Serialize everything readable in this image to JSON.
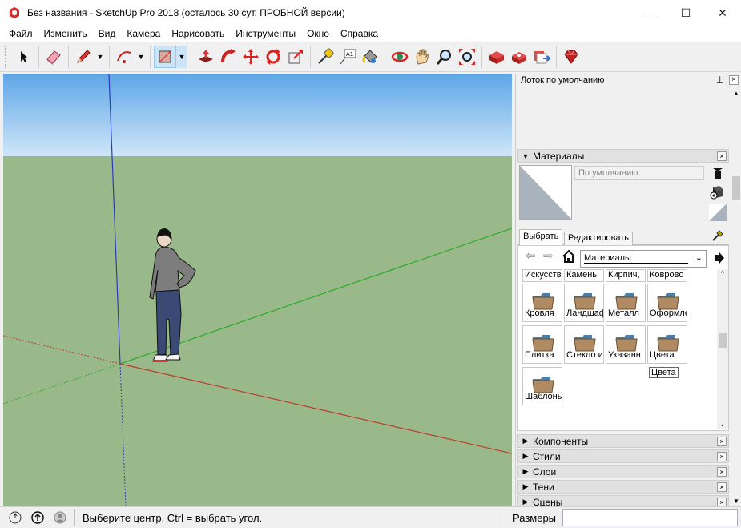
{
  "window": {
    "title": "Без названия - SketchUp Pro 2018 (осталось 30 сут. ПРОБНОЙ версии)",
    "minimize_glyph": "—",
    "maximize_glyph": "☐",
    "close_glyph": "✕"
  },
  "menu": [
    "Файл",
    "Изменить",
    "Вид",
    "Камера",
    "Нарисовать",
    "Инструменты",
    "Окно",
    "Справка"
  ],
  "toolbar": {
    "icons": [
      "select-icon",
      "eraser-icon",
      "pencil-icon",
      "arc-icon",
      "rectangle-icon",
      "push-pull-icon",
      "follow-me-icon",
      "move-icon",
      "rotate-icon",
      "scale-icon",
      "tape-measure-icon",
      "text-icon",
      "paint-bucket-icon",
      "orbit-icon",
      "pan-icon",
      "zoom-icon",
      "zoom-extents-icon",
      "warehouse-icon",
      "extension-warehouse-icon",
      "send-to-layout-icon",
      "ruby-icon"
    ],
    "text_tool_label": "A1"
  },
  "tray": {
    "title": "Лоток по умолчанию",
    "pin_glyph": "⊥",
    "close_glyph": "×",
    "materials": {
      "title": "Материалы",
      "name_value": "По умолчанию",
      "tabs": [
        "Выбрать",
        "Редактировать"
      ],
      "collection": "Материалы",
      "top_row": [
        "Искусств",
        "Камень",
        "Кирпич,",
        "Коврово"
      ],
      "tiles": [
        "Кровля",
        "Ландшаф",
        "Металл",
        "Оформле",
        "Плитка",
        "Стекло и",
        "Указанн",
        "Цвета",
        "Шаблоны"
      ],
      "tooltip": "Цвета"
    },
    "panels": [
      "Компоненты",
      "Стили",
      "Слои",
      "Тени",
      "Сцены"
    ]
  },
  "status": {
    "message": "Выберите центр. Ctrl = выбрать угол.",
    "measurements_label": "Размеры",
    "measurements_value": ""
  },
  "colors": {
    "sky_top": "#5ea6e8",
    "sky_bottom": "#cfe6f8",
    "ground": "#9ab98a",
    "red_axis": "#c0392b",
    "green_axis": "#2eab2e",
    "blue_axis": "#2b3cb8",
    "toolbar_active": "#cce4f7"
  }
}
